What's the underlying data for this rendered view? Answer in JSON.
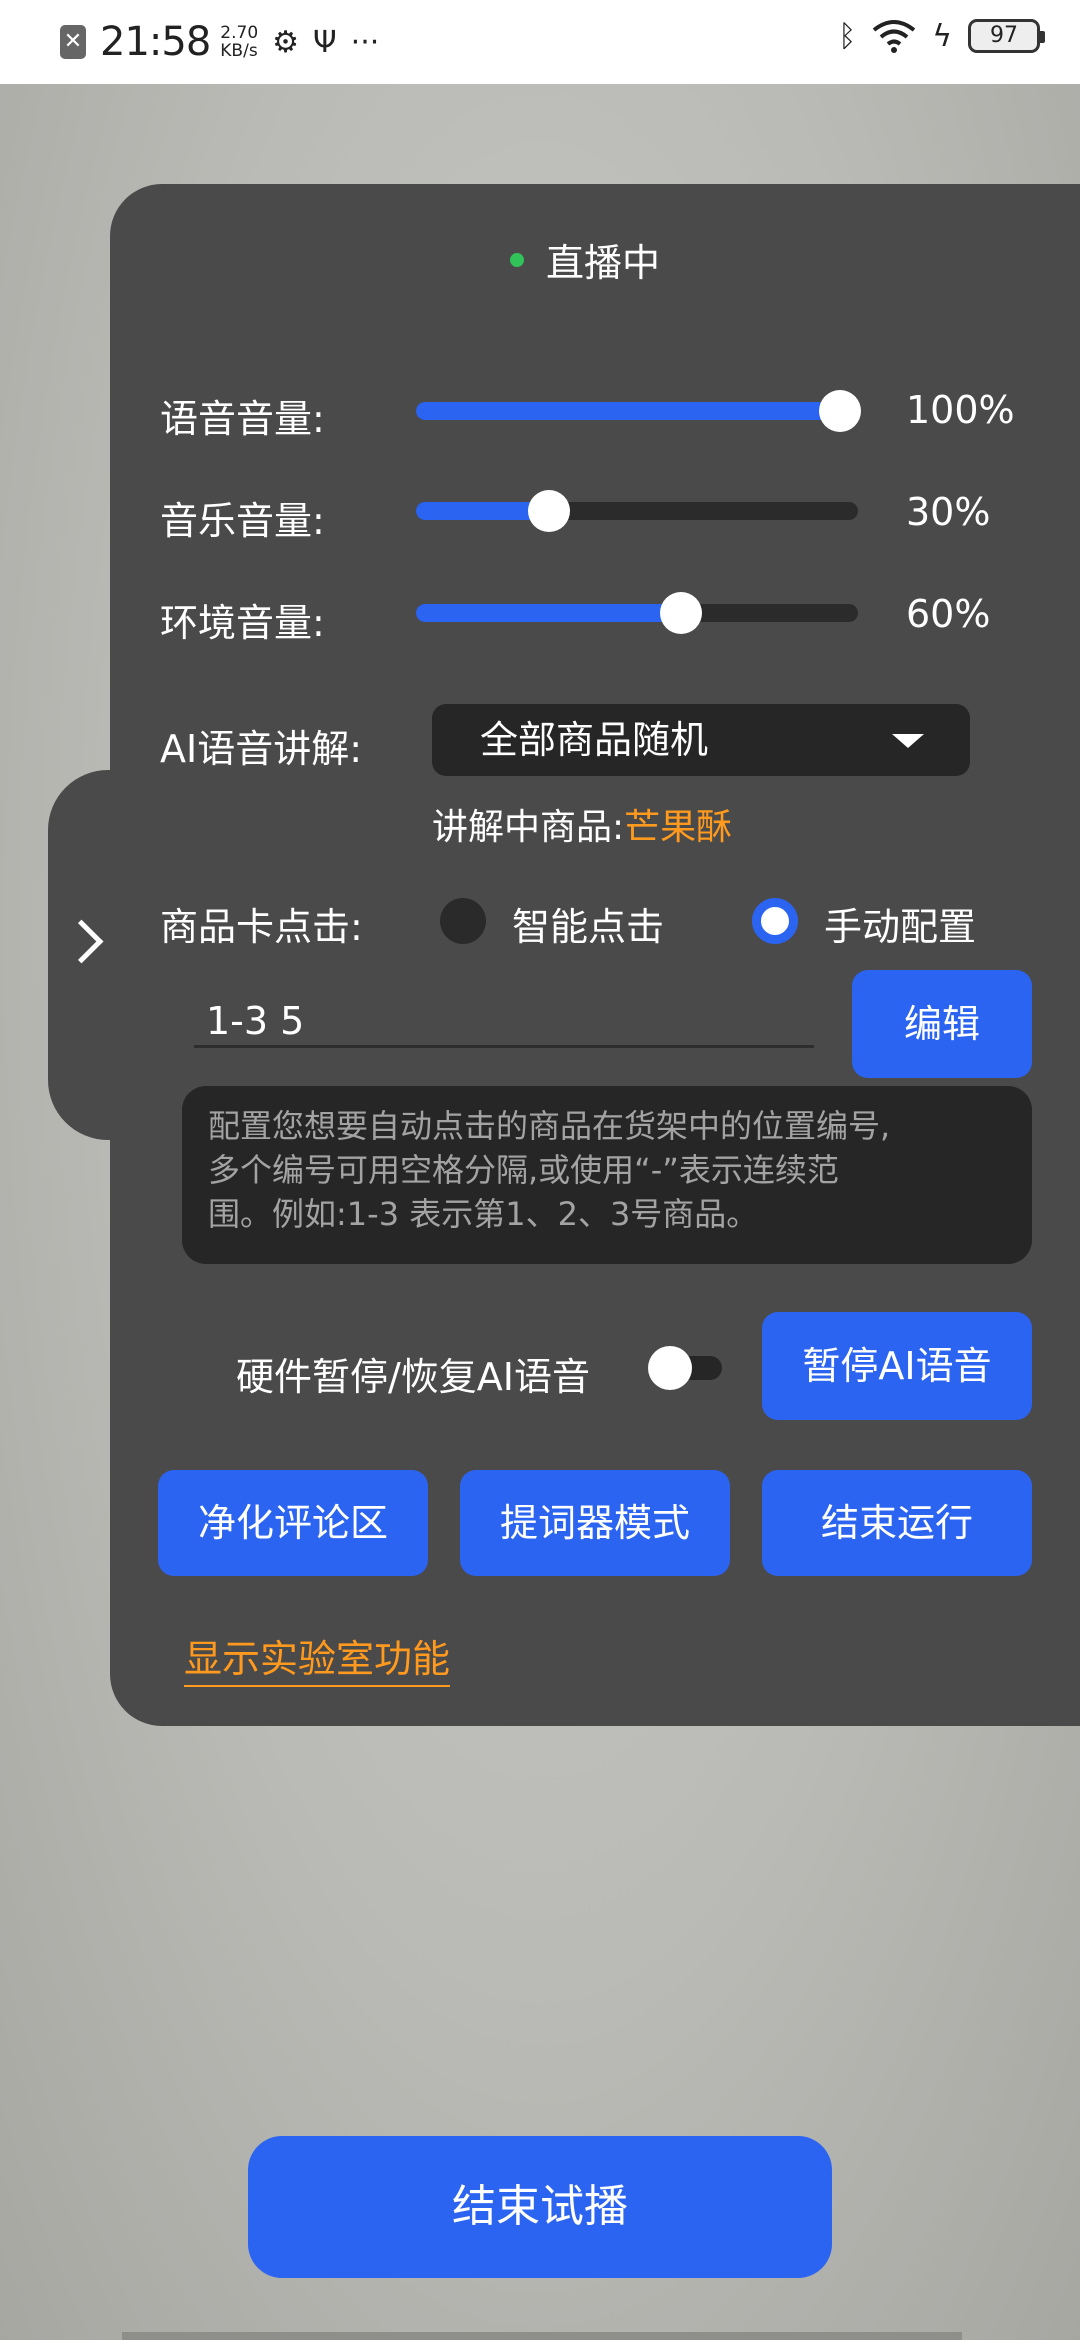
{
  "status_bar": {
    "time": "21:58",
    "speed_value": "2.70",
    "speed_unit": "KB/s",
    "battery": "97",
    "icons": [
      "close-notification-icon",
      "usb-debug-icon",
      "usb-icon",
      "more-dots-icon",
      "bluetooth-icon",
      "wifi-icon",
      "charging-icon",
      "battery-icon"
    ]
  },
  "panel": {
    "live_status": "直播中",
    "volumes": [
      {
        "label": "语音音量:",
        "percent": 100,
        "value_text": "100%"
      },
      {
        "label": "音乐音量:",
        "percent": 30,
        "value_text": "30%"
      },
      {
        "label": "环境音量:",
        "percent": 60,
        "value_text": "60%"
      }
    ],
    "ai_explain_label": "AI语音讲解:",
    "ai_explain_selected": "全部商品随机",
    "current_product_label": "讲解中商品:",
    "current_product_value": "芒果酥",
    "card_click_label": "商品卡点击:",
    "option_smart": "智能点击",
    "option_manual": "手动配置",
    "selected_option": "手动配置",
    "positions_value": "1-3 5",
    "edit_button": "编辑",
    "hint_lines": [
      "配置您想要自动点击的商品在货架中的位置编号,",
      "多个编号可用空格分隔,或使用“-”表示连续范",
      "围。例如:1-3 表示第1、2、3号商品。"
    ],
    "hardware_label": "硬件暂停/恢复AI语音",
    "hardware_toggle_on": false,
    "pause_ai_button": "暂停AI语音",
    "clean_comments_button": "净化评论区",
    "prompter_button": "提词器模式",
    "end_run_button": "结束运行",
    "show_lab_link": "显示实验室功能"
  },
  "end_trial_button": "结束试播",
  "colors": {
    "accent": "#2c64f2",
    "orange": "#ff9a1f",
    "panel": "#4a4a4a",
    "live_dot": "#31c35a"
  }
}
